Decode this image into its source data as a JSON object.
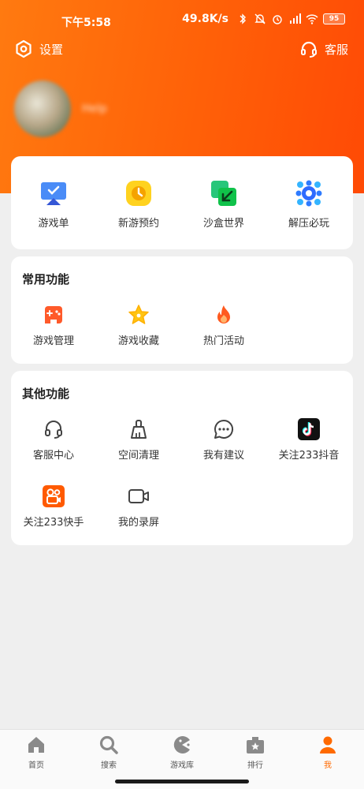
{
  "status_bar": {
    "time": "下午5:58",
    "net_speed": "49.8K/s",
    "battery": "95"
  },
  "top": {
    "settings_label": "设置",
    "service_label": "客服"
  },
  "profile": {
    "username": "Help"
  },
  "quick_entries": [
    {
      "label": "游戏单",
      "icon": "game-list-icon"
    },
    {
      "label": "新游预约",
      "icon": "clock-icon"
    },
    {
      "label": "沙盒世界",
      "icon": "sandbox-icon"
    },
    {
      "label": "解压必玩",
      "icon": "relax-icon"
    }
  ],
  "common": {
    "title": "常用功能",
    "items": [
      {
        "label": "游戏管理",
        "icon": "gamepad-icon"
      },
      {
        "label": "游戏收藏",
        "icon": "star-icon"
      },
      {
        "label": "热门活动",
        "icon": "flame-icon"
      }
    ]
  },
  "other": {
    "title": "其他功能",
    "items": [
      {
        "label": "客服中心",
        "icon": "headset-icon"
      },
      {
        "label": "空间清理",
        "icon": "broom-icon"
      },
      {
        "label": "我有建议",
        "icon": "chat-icon"
      },
      {
        "label": "关注233抖音",
        "icon": "douyin-icon"
      },
      {
        "label": "关注233快手",
        "icon": "kuaishou-icon"
      },
      {
        "label": "我的录屏",
        "icon": "video-camera-icon"
      }
    ]
  },
  "tabs": [
    {
      "label": "首页",
      "icon": "home-icon"
    },
    {
      "label": "搜索",
      "icon": "search-icon"
    },
    {
      "label": "游戏库",
      "icon": "pacman-icon"
    },
    {
      "label": "排行",
      "icon": "ranking-icon"
    },
    {
      "label": "我",
      "icon": "person-icon"
    }
  ],
  "colors": {
    "accent": "#ff6a00",
    "header_start": "#ff7a10",
    "header_end": "#ff4a05"
  }
}
